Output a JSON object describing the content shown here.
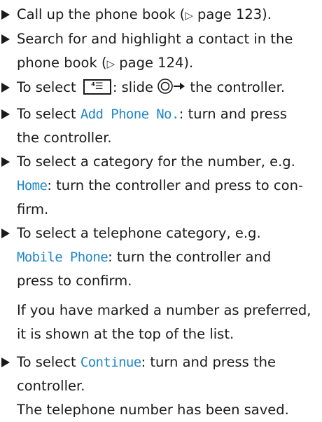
{
  "steps": {
    "s1": {
      "text": "Call up the phone book (",
      "ref": "▷",
      "page": " page 123)."
    },
    "s2": {
      "line1": "Search for and highlight a contact in the",
      "line2a": "phone book (",
      "ref": "▷",
      "line2b": " page 124)."
    },
    "s3": {
      "pre": "To select ",
      "key_glyph": "⁴☰",
      "mid": ": slide ",
      "ctrl_icon": "controller-slide-right",
      "post": " the controller."
    },
    "s4": {
      "pre": "To select ",
      "hl": "Add Phone No.",
      "post": ": turn and press",
      "line2": "the controller."
    },
    "s5": {
      "line1": "To select a category for the number, e.g.",
      "hl": "Home",
      "post": ": turn the controller and press to con-",
      "line3": "firm."
    },
    "s6": {
      "line1": "To select a telephone category, e.g.",
      "hl": "Mobile Phone",
      "post": ": turn the controller and",
      "line3": "press to confirm."
    },
    "note": {
      "line1": "If you have marked a number as preferred,",
      "line2": "it is shown at the top of the list."
    },
    "s7": {
      "pre": "To select ",
      "hl": "Continue",
      "post": ": turn and press the",
      "line2": "controller."
    },
    "result": "The telephone number has been saved."
  },
  "colors": {
    "highlight": "#1f86c8",
    "text": "#1a1a1a"
  }
}
